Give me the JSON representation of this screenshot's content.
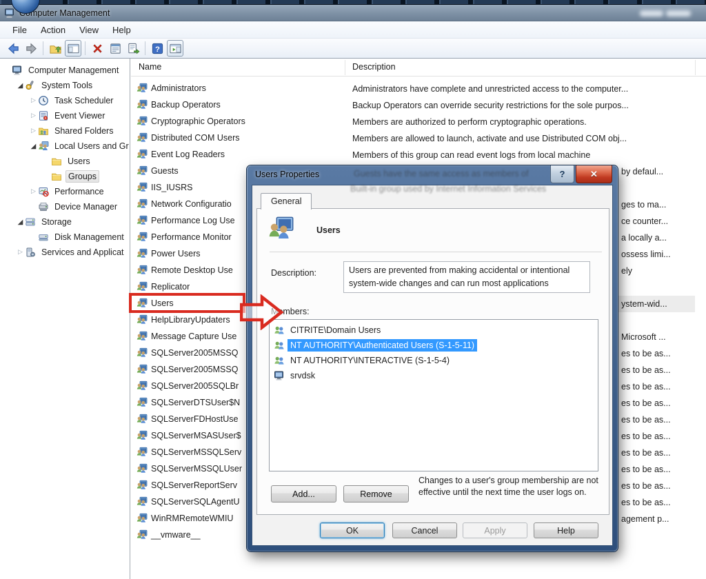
{
  "window": {
    "title": "Computer Management"
  },
  "menubar": {
    "items": [
      "File",
      "Action",
      "View",
      "Help"
    ]
  },
  "toolbar": {
    "items": [
      {
        "icon": "back-arrow-icon"
      },
      {
        "icon": "forward-arrow-icon",
        "sep_after": true
      },
      {
        "icon": "up-one-level-icon"
      },
      {
        "icon": "show-console-tree-icon",
        "framed": true,
        "sep_after": true
      },
      {
        "icon": "delete-icon"
      },
      {
        "icon": "properties-icon"
      },
      {
        "icon": "export-list-icon",
        "sep_after": true
      },
      {
        "icon": "help-icon"
      },
      {
        "icon": "show-action-pane-icon",
        "framed": true
      }
    ]
  },
  "tree": {
    "items": [
      {
        "label": "Computer Management",
        "depth": 0,
        "state": "none",
        "icon": "computer-icon"
      },
      {
        "label": "System Tools",
        "depth": 1,
        "state": "expanded",
        "icon": "system-tools-icon"
      },
      {
        "label": "Task Scheduler",
        "depth": 2,
        "state": "collapsed",
        "icon": "task-scheduler-icon"
      },
      {
        "label": "Event Viewer",
        "depth": 2,
        "state": "collapsed",
        "icon": "event-viewer-icon"
      },
      {
        "label": "Shared Folders",
        "depth": 2,
        "state": "collapsed",
        "icon": "shared-folders-icon"
      },
      {
        "label": "Local Users and Gr",
        "depth": 2,
        "state": "expanded",
        "icon": "local-users-icon"
      },
      {
        "label": "Users",
        "depth": 3,
        "state": "none",
        "icon": "folder-icon"
      },
      {
        "label": "Groups",
        "depth": 3,
        "state": "none",
        "icon": "folder-icon",
        "selected": true
      },
      {
        "label": "Performance",
        "depth": 2,
        "state": "collapsed",
        "icon": "performance-icon"
      },
      {
        "label": "Device Manager",
        "depth": 2,
        "state": "none",
        "icon": "device-manager-icon"
      },
      {
        "label": "Storage",
        "depth": 1,
        "state": "expanded",
        "icon": "storage-icon"
      },
      {
        "label": "Disk Management",
        "depth": 2,
        "state": "none",
        "icon": "disk-management-icon"
      },
      {
        "label": "Services and Applicat",
        "depth": 1,
        "state": "collapsed",
        "icon": "services-icon"
      }
    ]
  },
  "list": {
    "columns": [
      "Name",
      "Description"
    ],
    "rows": [
      {
        "name": "Administrators",
        "description": "Administrators have complete and unrestricted access to the computer..."
      },
      {
        "name": "Backup Operators",
        "description": "Backup Operators can override security restrictions for the sole purpos..."
      },
      {
        "name": "Cryptographic Operators",
        "description": "Members are authorized to perform cryptographic operations."
      },
      {
        "name": "Distributed COM Users",
        "description": "Members are allowed to launch, activate and use Distributed COM obj..."
      },
      {
        "name": "Event Log Readers",
        "description": "Members of this group can read event logs from local machine"
      },
      {
        "name": "Guests",
        "fragment": "by defaul..."
      },
      {
        "name": "IIS_IUSRS"
      },
      {
        "name": "Network Configuratio",
        "fragment": "ges to ma..."
      },
      {
        "name": "Performance Log Use",
        "fragment": "ce counter..."
      },
      {
        "name": "Performance Monitor",
        "fragment": "a locally a..."
      },
      {
        "name": "Power Users",
        "fragment": "ossess limi..."
      },
      {
        "name": "Remote Desktop Use",
        "fragment": "ely"
      },
      {
        "name": "Replicator"
      },
      {
        "name": "Users",
        "fragment": "ystem-wid...",
        "selected": true
      },
      {
        "name": "HelpLibraryUpdaters"
      },
      {
        "name": "Message Capture Use",
        "fragment": "Microsoft ..."
      },
      {
        "name": "SQLServer2005MSSQ",
        "fragment": "es to be as..."
      },
      {
        "name": "SQLServer2005MSSQ",
        "fragment": "es to be as..."
      },
      {
        "name": "SQLServer2005SQLBr",
        "fragment": "es to be as..."
      },
      {
        "name": "SQLServerDTSUser$N",
        "fragment": "es to be as..."
      },
      {
        "name": "SQLServerFDHostUse",
        "fragment": "es to be as..."
      },
      {
        "name": "SQLServerMSASUser$",
        "fragment": "es to be as..."
      },
      {
        "name": "SQLServerMSSQLServ",
        "fragment": "es to be as..."
      },
      {
        "name": "SQLServerMSSQLUser",
        "fragment": "es to be as..."
      },
      {
        "name": "SQLServerReportServ",
        "fragment": "es to be as..."
      },
      {
        "name": "SQLServerSQLAgentU",
        "fragment": "es to be as..."
      },
      {
        "name": "WinRMRemoteWMIU",
        "fragment": "agement p..."
      },
      {
        "name": "__vmware__"
      }
    ]
  },
  "dialog": {
    "title": "Users Properties",
    "tab": "General",
    "object_name": "Users",
    "description_label": "Description:",
    "description_value": "Users are prevented from making accidental or intentional system-wide changes and can run most applications",
    "members_label": "Members:",
    "members": [
      {
        "name": "CITRITE\\Domain Users",
        "icon": "member-group-icon"
      },
      {
        "name": "NT AUTHORITY\\Authenticated Users (S-1-5-11)",
        "icon": "member-group-icon",
        "selected": true
      },
      {
        "name": "NT AUTHORITY\\INTERACTIVE (S-1-5-4)",
        "icon": "member-group-icon"
      },
      {
        "name": "srvdsk",
        "icon": "member-computer-icon"
      }
    ],
    "add_label": "Add...",
    "remove_label": "Remove",
    "note": "Changes to a user's group membership are not effective until the next time the user logs on.",
    "buttons": {
      "ok": "OK",
      "cancel": "Cancel",
      "apply": "Apply",
      "help": "Help"
    },
    "help_glyph": "?",
    "close_glyph": "✕",
    "ghost_lines": [
      "Guests have the same access as members of",
      "Built-in group used by Internet Information Services"
    ]
  },
  "annotation": {
    "color": "#d92b20"
  }
}
